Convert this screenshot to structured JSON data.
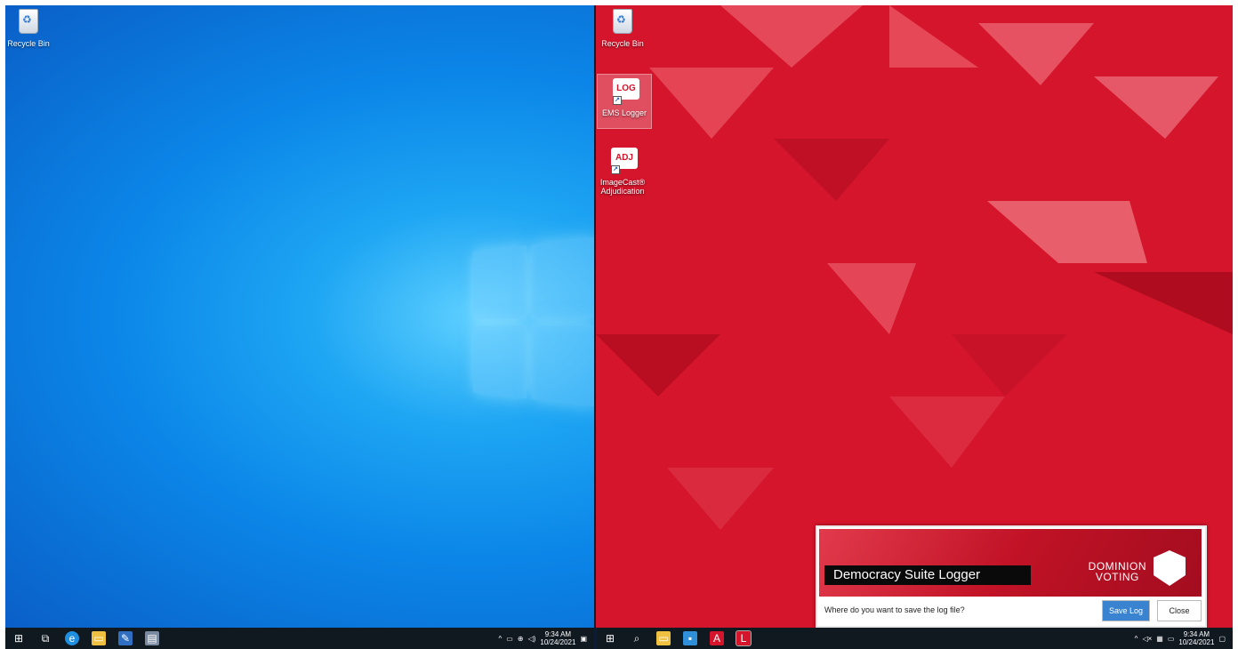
{
  "left_desktop": {
    "icons": [
      {
        "label": "Recycle Bin"
      }
    ]
  },
  "right_desktop": {
    "icons": [
      {
        "label": "Recycle Bin"
      },
      {
        "label": "EMS Logger",
        "badge": "LOG"
      },
      {
        "label": "ImageCast® Adjudication",
        "badge": "ADJ"
      }
    ]
  },
  "logger_dialog": {
    "title": "Democracy Suite Logger",
    "brand_line1": "DOMINION",
    "brand_line2": "VOTING",
    "question": "Where do you want to save the log file?",
    "save_label": "Save Log",
    "close_label": "Close"
  },
  "left_taskbar": {
    "time": "9:34 AM",
    "date": "10/24/2021"
  },
  "right_taskbar": {
    "time": "9:34 AM",
    "date": "10/24/2021"
  },
  "colors": {
    "left_bg": "#0b86e8",
    "right_bg": "#d5152b",
    "taskbar": "#101820",
    "save_button": "#3a83d1"
  }
}
